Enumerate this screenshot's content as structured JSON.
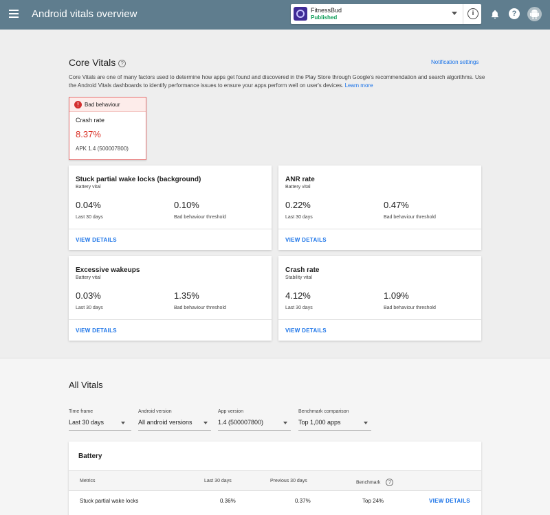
{
  "header": {
    "title": "Android vitals overview",
    "app": {
      "name": "FitnessBud",
      "status": "Published"
    },
    "info_glyph": "i",
    "help_glyph": "?"
  },
  "core_vitals": {
    "title": "Core Vitals",
    "help_glyph": "?",
    "notification_settings": "Notification settings",
    "description": "Core Vitals are one of many factors used to determine how apps get found and discovered in the Play Store through Google's recommendation and search algorithms. Use the Android Vitals dashboards to identify performance issues to ensure your apps perform well on user's devices.",
    "learn_more": "Learn more",
    "bad_card": {
      "glyph": "!",
      "label": "Bad behaviour",
      "metric": "Crash rate",
      "value": "8.37%",
      "apk": "APK 1.4 (500007800)"
    },
    "cards": [
      {
        "title": "Stuck partial wake locks (background)",
        "subtitle": "Battery vital",
        "value": "0.04%",
        "value_label": "Last 30 days",
        "threshold": "0.10%",
        "threshold_label": "Bad behaviour threshold",
        "link": "VIEW DETAILS"
      },
      {
        "title": "ANR rate",
        "subtitle": "Battery vital",
        "value": "0.22%",
        "value_label": "Last 30 days",
        "threshold": "0.47%",
        "threshold_label": "Bad behaviour threshold",
        "link": "VIEW DETAILS"
      },
      {
        "title": "Excessive wakeups",
        "subtitle": "Battery vital",
        "value": "0.03%",
        "value_label": "Last 30 days",
        "threshold": "1.35%",
        "threshold_label": "Bad behaviour threshold",
        "link": "VIEW DETAILS"
      },
      {
        "title": "Crash rate",
        "subtitle": "Stability vital",
        "value": "4.12%",
        "value_label": "Last 30 days",
        "threshold": "1.09%",
        "threshold_label": "Bad behaviour threshold",
        "link": "VIEW DETAILS"
      }
    ]
  },
  "all_vitals": {
    "title": "All Vitals",
    "filters": [
      {
        "label": "Time frame",
        "value": "Last 30 days"
      },
      {
        "label": "Android version",
        "value": "All android versions"
      },
      {
        "label": "App version",
        "value": "1.4 (500007800)"
      },
      {
        "label": "Benchmark comparison",
        "value": "Top 1,000 apps"
      }
    ],
    "battery": {
      "title": "Battery",
      "help_glyph": "?",
      "columns": [
        "Metrics",
        "Last 30 days",
        "Previous 30 days",
        "Benchmark"
      ],
      "rows": [
        {
          "metric": "Stuck partial wake locks",
          "last": "0.36%",
          "previous": "0.37%",
          "benchmark": "Top 24%",
          "link": "VIEW DETAILS"
        }
      ]
    }
  },
  "colors": {
    "topbar": "#5f7d8e",
    "link": "#1a73e8",
    "bad": "#d93025",
    "published": "#0f9d58"
  }
}
